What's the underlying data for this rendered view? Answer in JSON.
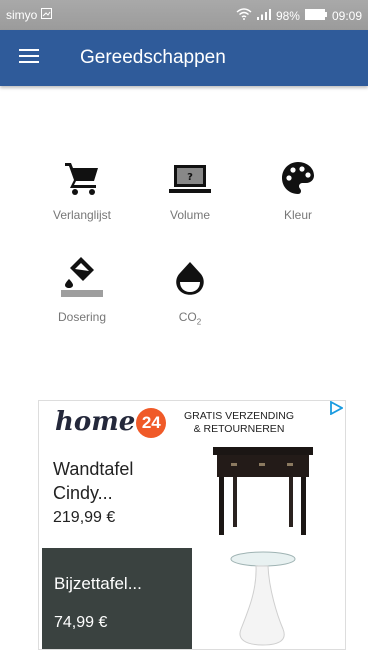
{
  "status_bar": {
    "carrier": "simyo",
    "battery": "98%",
    "time": "09:09"
  },
  "app_bar": {
    "title": "Gereedschappen",
    "menu_icon": "hamburger-menu-icon"
  },
  "tools": [
    {
      "label": "Verlanglijst",
      "icon": "cart-icon"
    },
    {
      "label": "Volume",
      "icon": "laptop-question-icon"
    },
    {
      "label": "Kleur",
      "icon": "palette-icon"
    },
    {
      "label": "Dosering",
      "icon": "paint-bucket-icon"
    },
    {
      "label_main": "CO",
      "label_sub": "2",
      "icon": "water-drop-icon"
    }
  ],
  "ad": {
    "logo_text": "home",
    "logo_number": "24",
    "promo": "GRATIS VERZENDING\n& RETOURNEREN",
    "product1": {
      "name": "Wandtafel Cindy...",
      "price": "219,99 €"
    },
    "product2": {
      "name": "Bijzettafel...",
      "price": "74,99 €"
    },
    "accent_color": "#f05a28",
    "choices_color": "#1a9be0"
  },
  "colors": {
    "app_bar": "#2f5b9a",
    "status_bar": "#a9a9a9",
    "label": "#777777"
  }
}
